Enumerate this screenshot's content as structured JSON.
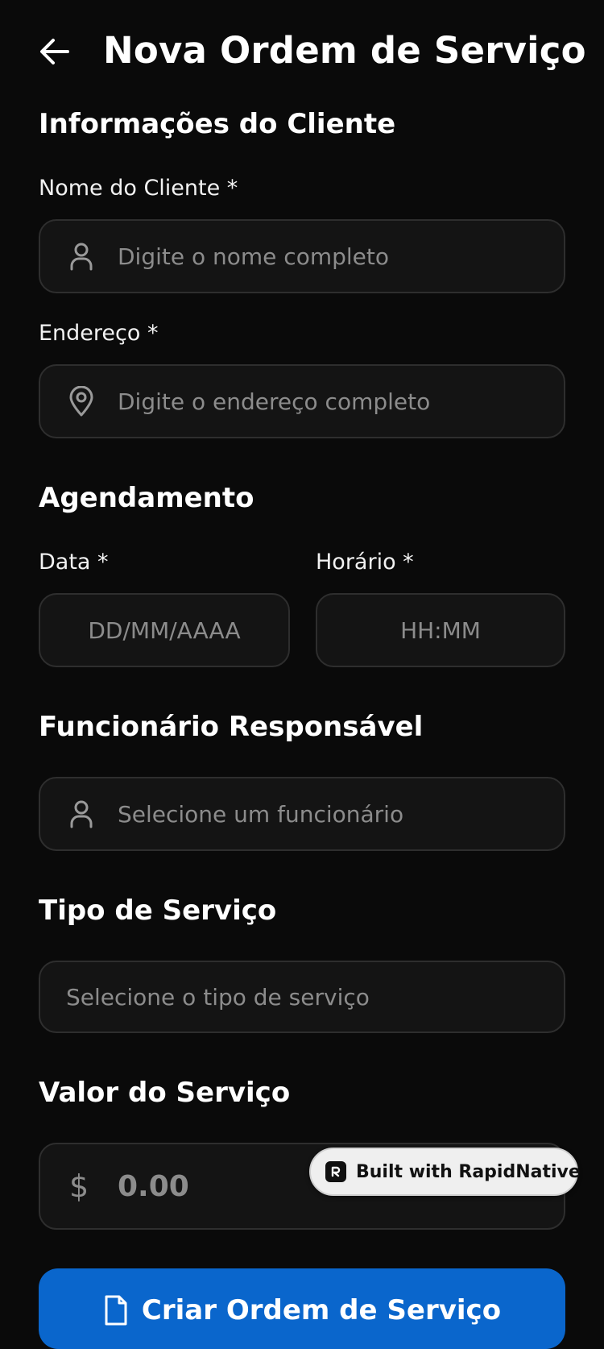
{
  "header": {
    "title": "Nova Ordem de Serviço"
  },
  "client_section": {
    "title": "Informações do Cliente",
    "name_label": "Nome do Cliente *",
    "name_placeholder": "Digite o nome completo",
    "address_label": "Endereço *",
    "address_placeholder": "Digite o endereço completo"
  },
  "schedule_section": {
    "title": "Agendamento",
    "date_label": "Data *",
    "date_placeholder": "DD/MM/AAAA",
    "time_label": "Horário *",
    "time_placeholder": "HH:MM"
  },
  "employee_section": {
    "title": "Funcionário Responsável",
    "placeholder": "Selecione um funcionário"
  },
  "service_type_section": {
    "title": "Tipo de Serviço",
    "placeholder": "Selecione o tipo de serviço"
  },
  "value_section": {
    "title": "Valor do Serviço",
    "currency_symbol": "$",
    "placeholder": "0.00"
  },
  "badge": {
    "label": "Built with RapidNative"
  },
  "submit": {
    "label": "Criar Ordem de Serviço"
  },
  "icons": {
    "back": "arrow-left-icon",
    "user": "user-icon",
    "location": "map-pin-icon",
    "file": "file-icon",
    "brand": "rapidnative-logo-icon"
  },
  "colors": {
    "background": "#0a0a0a",
    "input_background": "#141414",
    "input_border": "#2e2e2e",
    "placeholder": "#8c8c8c",
    "primary": "#0a66cc",
    "badge_background": "#efefef"
  }
}
